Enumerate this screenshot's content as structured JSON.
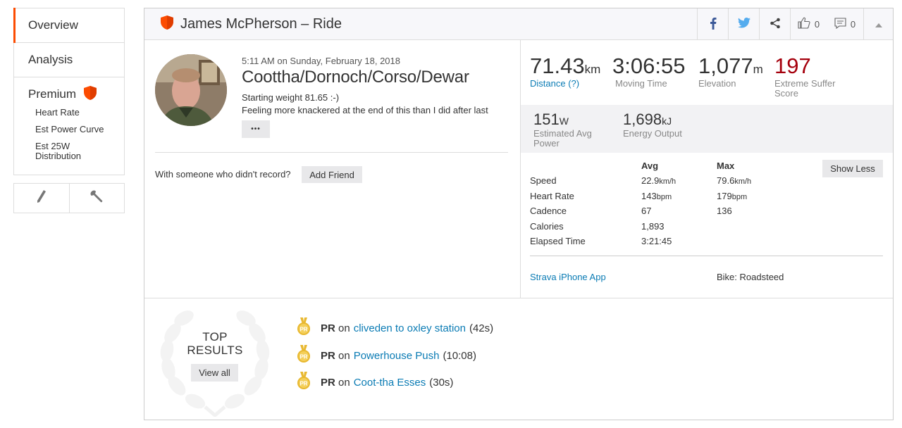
{
  "sidebar": {
    "items": [
      {
        "label": "Overview"
      },
      {
        "label": "Analysis"
      }
    ],
    "premium": {
      "label": "Premium",
      "subitems": [
        "Heart Rate",
        "Est Power Curve",
        "Est 25W Distribution"
      ]
    }
  },
  "header": {
    "title": "James McPherson – Ride",
    "kudos_count": "0",
    "comment_count": "0"
  },
  "activity": {
    "datetime": "5:11 AM on Sunday, February 18, 2018",
    "name": "Coottha/Dornoch/Corso/Dewar",
    "description_line1": "Starting weight 81.65 :-)",
    "description_line2": "Feeling more knackered at the end of this than I did after last",
    "more_label": "•••",
    "friend_question": "With someone who didn't record?",
    "add_friend_label": "Add Friend"
  },
  "stats": {
    "distance": {
      "value": "71.43",
      "unit": "km",
      "label": "Distance (?)"
    },
    "moving_time": {
      "value": "3:06:55",
      "label": "Moving Time"
    },
    "elevation": {
      "value": "1,077",
      "unit": "m",
      "label": "Elevation"
    },
    "suffer": {
      "value": "197",
      "label_line1": "Extreme Suffer",
      "label_line2": "Score"
    },
    "power": {
      "value": "151",
      "unit": "W",
      "label_line1": "Estimated Avg",
      "label_line2": "Power"
    },
    "energy": {
      "value": "1,698",
      "unit": "kJ",
      "label": "Energy Output"
    }
  },
  "details": {
    "avg_header": "Avg",
    "max_header": "Max",
    "show_less_label": "Show Less",
    "rows": [
      {
        "label": "Speed",
        "avg": "22.9",
        "avg_unit": "km/h",
        "max": "79.6",
        "max_unit": "km/h"
      },
      {
        "label": "Heart Rate",
        "avg": "143",
        "avg_unit": "bpm",
        "max": "179",
        "max_unit": "bpm"
      },
      {
        "label": "Cadence",
        "avg": "67",
        "avg_unit": "",
        "max": "136",
        "max_unit": ""
      },
      {
        "label": "Calories",
        "avg": "1,893",
        "avg_unit": "",
        "max": "",
        "max_unit": ""
      },
      {
        "label": "Elapsed Time",
        "avg": "3:21:45",
        "avg_unit": "",
        "max": "",
        "max_unit": ""
      }
    ],
    "device": "Strava iPhone App",
    "bike": "Bike: Roadsteed"
  },
  "top_results": {
    "title_line1": "TOP",
    "title_line2": "RESULTS",
    "view_all_label": "View all",
    "pr_label": "PR",
    "on_label": "on",
    "items": [
      {
        "segment": "cliveden to oxley station",
        "time": "(42s)"
      },
      {
        "segment": "Powerhouse Push",
        "time": "(10:08)"
      },
      {
        "segment": "Coot-tha Esses",
        "time": "(30s)"
      }
    ]
  },
  "colors": {
    "accent": "#fc4c02",
    "link": "#0a7bb4",
    "suffer_red": "#a5000d",
    "medal_gold": "#e8b830"
  }
}
